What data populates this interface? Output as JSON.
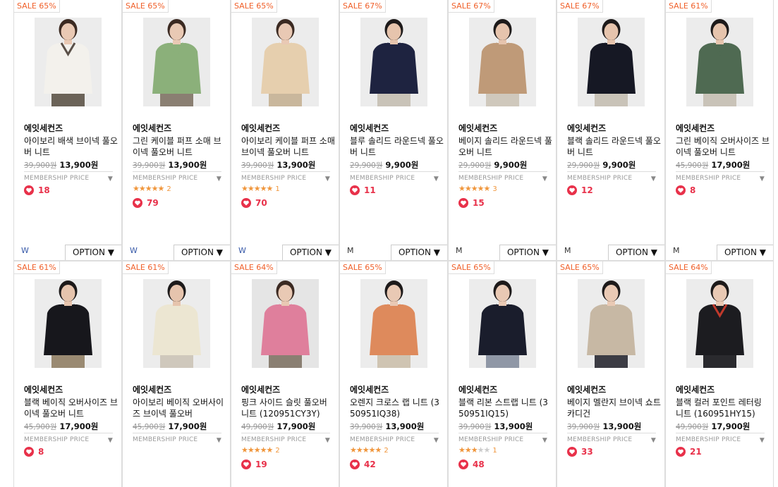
{
  "products": [
    {
      "sale": "SALE 65%",
      "brand": "에잇세컨즈",
      "name": "아이보리 배색 브이넥 풀오버 니트",
      "orig": "39,900원",
      "price": "13,900원",
      "member": "MEMBERSHIP PRICE",
      "stars": 0,
      "reviews": "",
      "likes": "18",
      "size": "W",
      "option": "OPTION ▼",
      "img": {
        "bg": "#ececec",
        "skin": "#e9c9b4",
        "hair": "#3b2a22",
        "top": "#f3f1ec",
        "accent": "#5a5048",
        "bottom": "#6b6358"
      }
    },
    {
      "sale": "SALE 65%",
      "brand": "에잇세컨즈",
      "name": "그린 케이블 퍼프 소매 브이넥 풀오버 니트",
      "orig": "39,900원",
      "price": "13,900원",
      "member": "MEMBERSHIP PRICE",
      "stars": 5,
      "reviews": "2",
      "likes": "79",
      "size": "W",
      "option": "OPTION ▼",
      "img": {
        "bg": "#ebebeb",
        "skin": "#e9c9b4",
        "hair": "#3b2a22",
        "top": "#8bb07a",
        "accent": "#8bb07a",
        "bottom": "#8a7f72"
      }
    },
    {
      "sale": "SALE 65%",
      "brand": "에잇세컨즈",
      "name": "아이보리 케이블 퍼프 소매 브이넥 풀오버 니트",
      "orig": "39,900원",
      "price": "13,900원",
      "member": "MEMBERSHIP PRICE",
      "stars": 5,
      "reviews": "1",
      "likes": "70",
      "size": "W",
      "option": "OPTION ▼",
      "img": {
        "bg": "#ececec",
        "skin": "#e9c9b4",
        "hair": "#3b2a22",
        "top": "#e6cfae",
        "accent": "#e6cfae",
        "bottom": "#c9b79c"
      }
    },
    {
      "sale": "SALE 67%",
      "brand": "에잇세컨즈",
      "name": "블루 솔리드 라운드넥 풀오버 니트",
      "orig": "29,900원",
      "price": "9,900원",
      "member": "MEMBERSHIP PRICE",
      "stars": 0,
      "reviews": "",
      "likes": "11",
      "size": "M",
      "option": "OPTION ▼",
      "img": {
        "bg": "#ececec",
        "skin": "#e6c4ad",
        "hair": "#1d1a1a",
        "top": "#1e2340",
        "accent": "#1e2340",
        "bottom": "#c9c3b8"
      }
    },
    {
      "sale": "SALE 67%",
      "brand": "에잇세컨즈",
      "name": "베이지 솔리드 라운드넥 풀오버 니트",
      "orig": "29,900원",
      "price": "9,900원",
      "member": "MEMBERSHIP PRICE",
      "stars": 5,
      "reviews": "3",
      "likes": "15",
      "size": "M",
      "option": "OPTION ▼",
      "img": {
        "bg": "#ececec",
        "skin": "#e6c4ad",
        "hair": "#1d1a1a",
        "top": "#bf9a78",
        "accent": "#bf9a78",
        "bottom": "#cfc8bc"
      }
    },
    {
      "sale": "SALE 67%",
      "brand": "에잇세컨즈",
      "name": "블랙 솔리드 라운드넥 풀오버 니트",
      "orig": "29,900원",
      "price": "9,900원",
      "member": "MEMBERSHIP PRICE",
      "stars": 0,
      "reviews": "",
      "likes": "12",
      "size": "M",
      "option": "OPTION ▼",
      "img": {
        "bg": "#ececec",
        "skin": "#e6c4ad",
        "hair": "#1d1a1a",
        "top": "#161824",
        "accent": "#161824",
        "bottom": "#c9c3b8"
      }
    },
    {
      "sale": "SALE 61%",
      "brand": "에잇세컨즈",
      "name": "그린 베이직 오버사이즈 브이넥 풀오버 니트",
      "orig": "45,900원",
      "price": "17,900원",
      "member": "MEMBERSHIP PRICE",
      "stars": 0,
      "reviews": "",
      "likes": "8",
      "size": "M",
      "option": "OPTION ▼",
      "img": {
        "bg": "#ececec",
        "skin": "#e6c4ad",
        "hair": "#1d1a1a",
        "top": "#4f6a52",
        "accent": "#4f6a52",
        "bottom": "#c9c3b8"
      }
    },
    {
      "sale": "SALE 61%",
      "brand": "에잇세컨즈",
      "name": "블랙 베이직 오버사이즈 브이넥 풀오버 니트",
      "orig": "45,900원",
      "price": "17,900원",
      "member": "MEMBERSHIP PRICE",
      "stars": 0,
      "reviews": "",
      "likes": "8",
      "size": "",
      "option": "",
      "img": {
        "bg": "#ececec",
        "skin": "#e6c4ad",
        "hair": "#1d1a1a",
        "top": "#17171c",
        "accent": "#17171c",
        "bottom": "#9a8a72"
      }
    },
    {
      "sale": "SALE 61%",
      "brand": "에잇세컨즈",
      "name": "아이보리 베이직 오버사이즈 브이넥 풀오버",
      "orig": "45,900원",
      "price": "17,900원",
      "member": "MEMBERSHIP PRICE",
      "stars": 0,
      "reviews": "",
      "likes": "",
      "size": "",
      "option": "",
      "img": {
        "bg": "#ececec",
        "skin": "#e6c4ad",
        "hair": "#1d1a1a",
        "top": "#ece6d2",
        "accent": "#ece6d2",
        "bottom": "#cfc8bc"
      }
    },
    {
      "sale": "SALE 64%",
      "brand": "에잇세컨즈",
      "name": "핑크 사이드 슬릿 풀오버 니트 (120951CY3Y)",
      "orig": "49,900원",
      "price": "17,900원",
      "member": "MEMBERSHIP PRICE",
      "stars": 4.5,
      "reviews": "2",
      "likes": "19",
      "size": "",
      "option": "",
      "img": {
        "bg": "#e5e5e5",
        "skin": "#e9c9b4",
        "hair": "#3b2a22",
        "top": "#df7f9c",
        "accent": "#df7f9c",
        "bottom": "#8a7f72"
      }
    },
    {
      "sale": "SALE 65%",
      "brand": "에잇세컨즈",
      "name": "오렌지 크로스 랩 니트 (350951IQ38)",
      "orig": "39,900원",
      "price": "13,900원",
      "member": "MEMBERSHIP PRICE",
      "stars": 4.5,
      "reviews": "2",
      "likes": "42",
      "size": "",
      "option": "",
      "img": {
        "bg": "#ececec",
        "skin": "#e9c9b4",
        "hair": "#1d1a1a",
        "top": "#de8a5c",
        "accent": "#de8a5c",
        "bottom": "#cfc4b2"
      }
    },
    {
      "sale": "SALE 65%",
      "brand": "에잇세컨즈",
      "name": "블랙 리본 스트랩 니트 (350951IQ15)",
      "orig": "39,900원",
      "price": "13,900원",
      "member": "MEMBERSHIP PRICE",
      "stars": 3,
      "reviews": "1",
      "likes": "48",
      "size": "",
      "option": "",
      "img": {
        "bg": "#ececec",
        "skin": "#e9c9b4",
        "hair": "#1d1a1a",
        "top": "#1a1d2c",
        "accent": "#1a1d2c",
        "bottom": "#8f97a6"
      }
    },
    {
      "sale": "SALE 65%",
      "brand": "에잇세컨즈",
      "name": "베이지 멜란지 브이넥 쇼트 카디건",
      "orig": "39,900원",
      "price": "13,900원",
      "member": "MEMBERSHIP PRICE",
      "stars": 0,
      "reviews": "",
      "likes": "33",
      "size": "",
      "option": "",
      "img": {
        "bg": "#ececec",
        "skin": "#e9c9b4",
        "hair": "#1d1a1a",
        "top": "#c7b8a4",
        "accent": "#c7b8a4",
        "bottom": "#3c3c44"
      }
    },
    {
      "sale": "SALE 64%",
      "brand": "에잇세컨즈",
      "name": "블랙 컬러 포인트 레터링 니트 (160951HY15)",
      "orig": "49,900원",
      "price": "17,900원",
      "member": "MEMBERSHIP PRICE",
      "stars": 0,
      "reviews": "",
      "likes": "21",
      "size": "",
      "option": "",
      "img": {
        "bg": "#ececec",
        "skin": "#e9c9b4",
        "hair": "#1d1a1a",
        "top": "#1c1c20",
        "accent": "#c0392b",
        "bottom": "#2a2a2e"
      }
    }
  ]
}
